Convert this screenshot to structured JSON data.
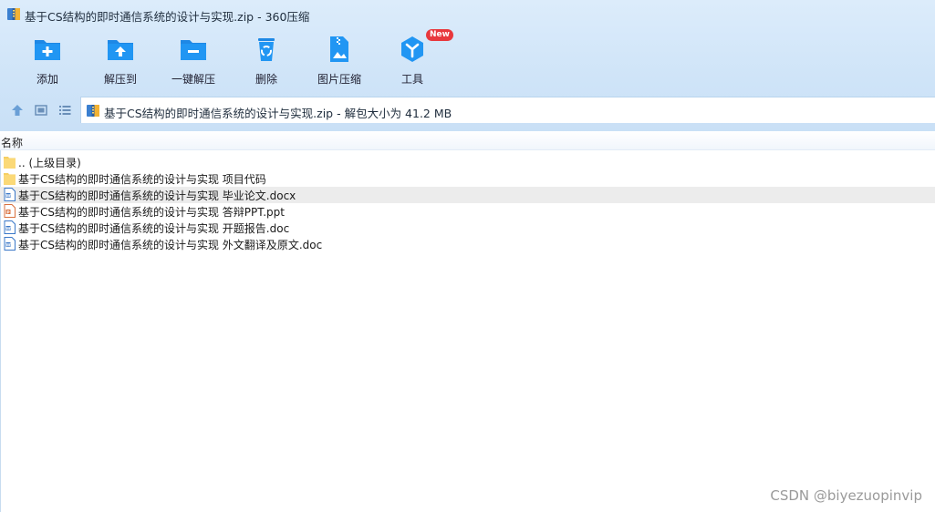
{
  "window": {
    "title": "基于CS结构的即时通信系统的设计与实现.zip - 360压缩"
  },
  "toolbar": {
    "items": [
      {
        "label": "添加",
        "icon": "add-folder-icon"
      },
      {
        "label": "解压到",
        "icon": "extract-to-icon"
      },
      {
        "label": "一键解压",
        "icon": "one-click-extract-icon"
      },
      {
        "label": "删除",
        "icon": "delete-recycle-icon"
      },
      {
        "label": "图片压缩",
        "icon": "image-compress-icon"
      },
      {
        "label": "工具",
        "icon": "tools-icon",
        "badge": "New"
      }
    ]
  },
  "nav": {
    "buttons": [
      "up-arrow-icon",
      "thumbnail-view-icon",
      "list-view-icon"
    ],
    "path": "基于CS结构的即时通信系统的设计与实现.zip - 解包大小为 41.2 MB"
  },
  "columns": {
    "name": "名称"
  },
  "files": [
    {
      "name": ".. (上级目录)",
      "type": "folder"
    },
    {
      "name": "基于CS结构的即时通信系统的设计与实现 项目代码",
      "type": "folder"
    },
    {
      "name": "基于CS结构的即时通信系统的设计与实现 毕业论文.docx",
      "type": "word",
      "selected": true
    },
    {
      "name": "基于CS结构的即时通信系统的设计与实现 答辩PPT.ppt",
      "type": "ppt"
    },
    {
      "name": "基于CS结构的即时通信系统的设计与实现 开题报告.doc",
      "type": "word"
    },
    {
      "name": "基于CS结构的即时通信系统的设计与实现 外文翻译及原文.doc",
      "type": "word"
    }
  ],
  "watermark": "CSDN @biyezuopinvip",
  "colors": {
    "accent": "#1e88e5",
    "header_bg": "#d6e9fa",
    "badge": "#e8383d",
    "selected_row": "#ececec"
  }
}
